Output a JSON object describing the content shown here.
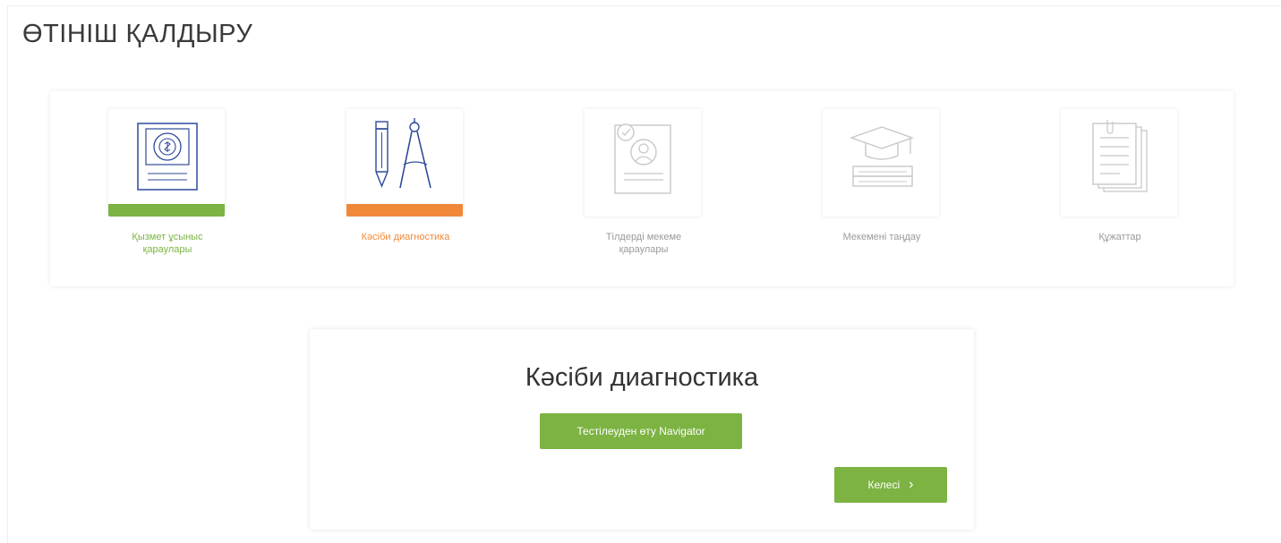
{
  "page": {
    "title": "ӨТІНІШ ҚАЛДЫРУ"
  },
  "steps": [
    {
      "label": "Қызмет ұсыныс қараулары",
      "bar_color": "#7cb342",
      "label_color": "#7cb342",
      "icon": "passport-icon",
      "state": "completed"
    },
    {
      "label": "Кәсіби диагностика",
      "bar_color": "#f0883a",
      "label_color": "#f0883a",
      "icon": "drafting-tools-icon",
      "state": "active"
    },
    {
      "label": "Тілдерді мекеме қараулары",
      "bar_color": "",
      "label_color": "#a0a0a0",
      "icon": "resume-icon",
      "state": "inactive"
    },
    {
      "label": "Мекемені таңдау",
      "bar_color": "",
      "label_color": "#a0a0a0",
      "icon": "graduation-icon",
      "state": "inactive"
    },
    {
      "label": "Құжаттар",
      "bar_color": "",
      "label_color": "#a0a0a0",
      "icon": "documents-icon",
      "state": "inactive"
    }
  ],
  "detail": {
    "title": "Кәсіби диагностика",
    "test_button_label": "Тестілеуден өту Navigator",
    "next_button_label": "Келесі",
    "next_icon": "chevron-right-icon"
  },
  "colors": {
    "accent_green": "#7cb342",
    "accent_orange": "#f0883a",
    "icon_blue": "#2d4a9a"
  }
}
